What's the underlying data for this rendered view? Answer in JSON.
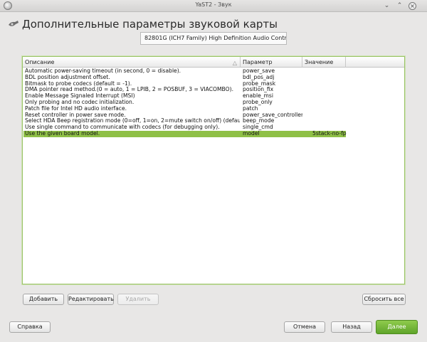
{
  "window": {
    "title": "YaST2 - Звук"
  },
  "page": {
    "title": "Дополнительные параметры звуковой карты",
    "device": "82801G (ICH7 Family) High Definition Audio Controller"
  },
  "table": {
    "headers": {
      "description": "Описание",
      "parameter": "Параметр",
      "value": "Значение"
    },
    "rows": [
      {
        "description": "Automatic power-saving timeout (in second, 0 = disable).",
        "parameter": "power_save",
        "value": ""
      },
      {
        "description": "BDL position adjustment offset.",
        "parameter": "bdl_pos_adj",
        "value": ""
      },
      {
        "description": "Bitmask to probe codecs (default = -1).",
        "parameter": "probe_mask",
        "value": ""
      },
      {
        "description": "DMA pointer read method.(0 = auto, 1 = LPIB, 2 = POSBUF, 3 = VIACOMBO).",
        "parameter": "position_fix",
        "value": ""
      },
      {
        "description": "Enable Message Signaled Interrupt (MSI)",
        "parameter": "enable_msi",
        "value": ""
      },
      {
        "description": "Only probing and no codec initialization.",
        "parameter": "probe_only",
        "value": ""
      },
      {
        "description": "Patch file for Intel HD audio interface.",
        "parameter": "patch",
        "value": ""
      },
      {
        "description": "Reset controller in power save mode.",
        "parameter": "power_save_controller",
        "value": ""
      },
      {
        "description": "Select HDA Beep registration mode (0=off, 1=on, 2=mute switch on/off) (default=1).",
        "parameter": "beep_mode",
        "value": ""
      },
      {
        "description": "Use single command to communicate with codecs (for debugging only).",
        "parameter": "single_cmd",
        "value": ""
      },
      {
        "description": "Use the given board model.",
        "parameter": "model",
        "value": "5stack-no-fp",
        "selected": true
      }
    ]
  },
  "buttons": {
    "add": "Добавить",
    "edit": "Редактировать",
    "delete": "Удалить",
    "reset_all": "Сбросить все",
    "help": "Справка",
    "cancel": "Отмена",
    "back": "Назад",
    "next": "Далее"
  },
  "colors": {
    "accent": "#8fc047",
    "primary_button": "#6cb22f"
  }
}
